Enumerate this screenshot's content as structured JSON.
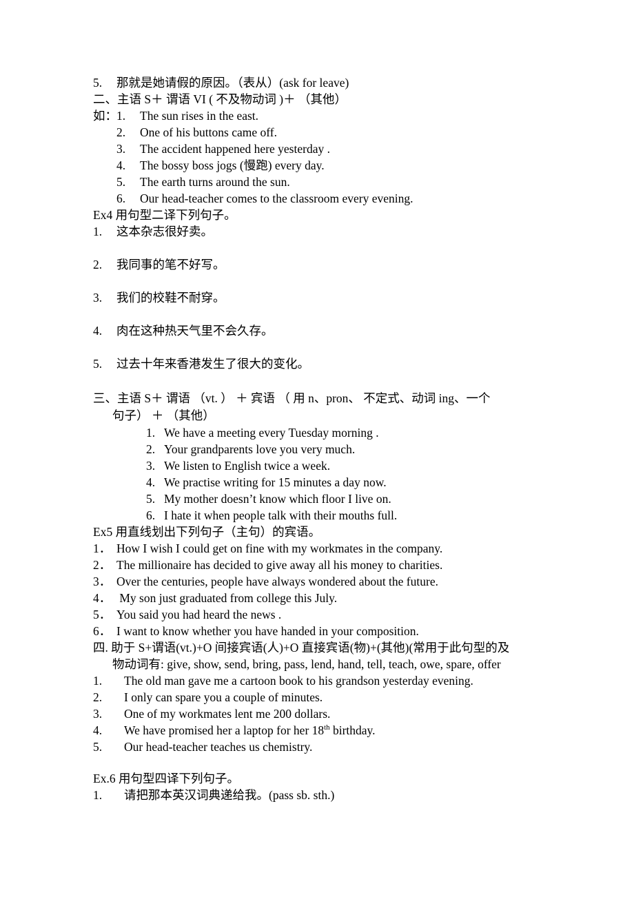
{
  "document": {
    "background_color": "#ffffff",
    "text_color": "#000000"
  },
  "sections": {
    "carryover_item": {
      "number": "5.",
      "text": "那就是她请假的原因。（表从）(ask for leave)"
    },
    "pattern2": {
      "heading": "二、主语 S＋ 谓语 VI ( 不及物动词 )＋ （其他）",
      "examples_prefix": "如：",
      "examples": [
        {
          "number": "1.",
          "text": "The sun rises in the east."
        },
        {
          "number": "2.",
          "text": "One of his buttons came off."
        },
        {
          "number": "3.",
          "text": "The accident happened here yesterday ."
        },
        {
          "number": "4.",
          "text": "The bossy boss jogs (慢跑) every day."
        },
        {
          "number": "5.",
          "text": "The earth turns around the sun."
        },
        {
          "number": "6.",
          "text": "Our head-teacher comes to the classroom every evening."
        }
      ]
    },
    "ex4": {
      "title": "Ex4 用句型二译下列句子。",
      "items": [
        {
          "number": "1.",
          "text": "这本杂志很好卖。"
        },
        {
          "number": "2.",
          "text": "我同事的笔不好写。"
        },
        {
          "number": "3.",
          "text": "我们的校鞋不耐穿。"
        },
        {
          "number": "4.",
          "text": "肉在这种热天气里不会久存。"
        },
        {
          "number": "5.",
          "text": "过去十年来香港发生了很大的变化。"
        }
      ]
    },
    "pattern3": {
      "heading_line1": "三、主语 S＋ 谓语 （vt. ） ＋ 宾语 （ 用 n、pron、 不定式、动词 ing、一个",
      "heading_line2": "句子） ＋ （其他）",
      "examples": [
        {
          "number": "1.",
          "text": "We have a meeting every Tuesday morning ."
        },
        {
          "number": "2.",
          "text": "Your grandparents love you very much."
        },
        {
          "number": "3.",
          "text": "We listen to English twice a week."
        },
        {
          "number": "4.",
          "text": "We practise writing for 15 minutes a day now."
        },
        {
          "number": "5.",
          "text": "My mother doesn’t know which floor I live on."
        },
        {
          "number": "6.",
          "text": "I hate it when people talk with their mouths full."
        }
      ]
    },
    "ex5": {
      "title": "Ex5 用直线划出下列句子（主句）的宾语。",
      "items": [
        {
          "number": "1．",
          "text": "How I wish I could get on fine with my workmates in the company."
        },
        {
          "number": "2．",
          "text": "The millionaire has decided to give away all his money to charities."
        },
        {
          "number": "3．",
          "text": "Over the centuries, people have always wondered about the future."
        },
        {
          "number": "4．",
          "text": " My son just graduated from college this July."
        },
        {
          "number": "5．",
          "text": "You said you had heard the news ."
        },
        {
          "number": "6．",
          "text": "I want to know whether you have handed in your composition."
        }
      ]
    },
    "pattern4": {
      "heading_line1": "四. 助于 S+谓语(vt.)+O 间接宾语(人)+O 直接宾语(物)+(其他)(常用于此句型的及",
      "heading_line2": "物动词有: give, show, send, bring, pass, lend, hand, tell, teach, owe, spare, offer",
      "examples": [
        {
          "number": "1.",
          "text": "The old man gave me a cartoon book to his grandson yesterday evening."
        },
        {
          "number": "2.",
          "text": "I only can spare you a couple of minutes."
        },
        {
          "number": "3.",
          "text": "One of my workmates lent me 200 dollars."
        },
        {
          "number": "4.",
          "text_pre": "We have promised her a laptop for her 18",
          "superscript": "th",
          "text_post": " birthday."
        },
        {
          "number": "5.",
          "text": "Our head-teacher teaches us chemistry."
        }
      ]
    },
    "ex6": {
      "title": "Ex.6 用句型四译下列句子。",
      "items": [
        {
          "number": "1.",
          "text": "请把那本英汉词典递给我。(pass sb. sth.)"
        }
      ]
    }
  }
}
